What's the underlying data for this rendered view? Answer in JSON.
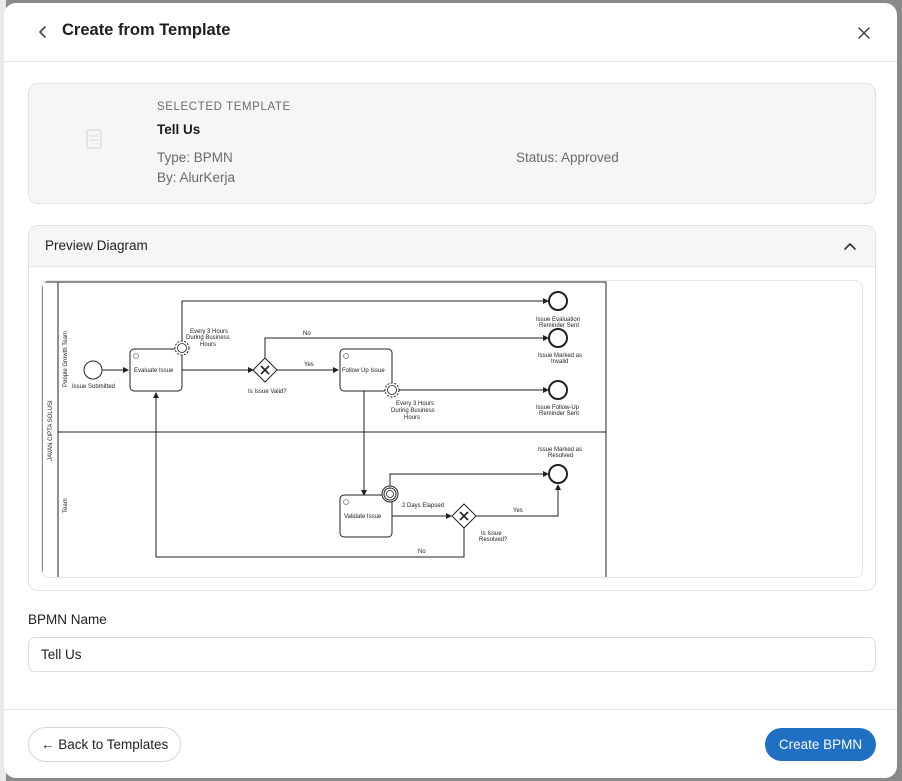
{
  "modal": {
    "title": "Create from Template",
    "icons": {
      "back": "chevron-left-icon",
      "close": "close-icon"
    }
  },
  "selected_template": {
    "section_label": "SELECTED TEMPLATE",
    "name": "Tell Us",
    "type": "Type: BPMN",
    "author": "By: AlurKerja",
    "status": "Status: Approved",
    "icon": "template-icon"
  },
  "preview": {
    "title": "Preview Diagram",
    "toggle_icon": "chevron-up-icon",
    "diagram": {
      "pool": "JAVAN CIPTA SOLUSI",
      "lanes": [
        "People Growth Team",
        "Team"
      ],
      "nodes": {
        "start": "Issue Submitted",
        "evaluate": "Evaluate Issue",
        "timer1": "Every 3 Hours During Business Hours",
        "gateway1": "Is Issue Valid?",
        "follow_up": "Follow Up Issue",
        "timer2": "Every 3 Hours During Business Hours",
        "end_reminder_eval": "Issue Evaluation Reminder Sent",
        "end_invalid": "Issue Marked as Invalid",
        "end_followup_reminder": "Issue Follow-Up Reminder Sent",
        "end_resolved": "Issue Marked as Resolved",
        "validate": "Validate Issue",
        "timer3": "2 Days Elapsed",
        "gateway2": "Is Issue Resolved?"
      },
      "flow_labels": {
        "no1": "No",
        "yes1": "Yes",
        "yes2": "Yes",
        "no2": "No"
      }
    }
  },
  "form": {
    "bpmn_name_label": "BPMN Name",
    "bpmn_name_value": "Tell Us"
  },
  "footer": {
    "back_label": "← Back to Templates",
    "create_label": "Create BPMN"
  },
  "colors": {
    "primary": "#1f6fc5",
    "card_bg": "#f6f6f6"
  }
}
